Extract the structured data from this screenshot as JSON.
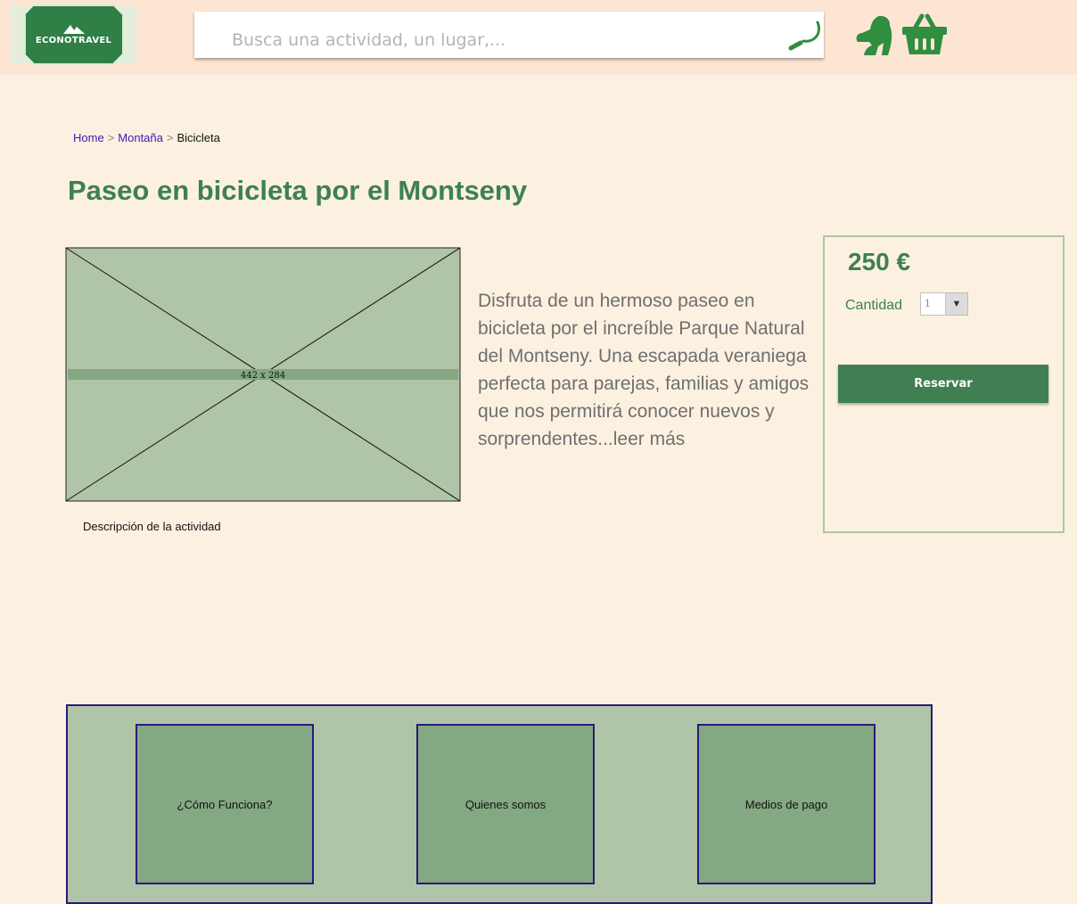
{
  "header": {
    "logo_text": "ECONOTRAVEL",
    "search": {
      "placeholder": "Busca una actividad, un lugar,..."
    }
  },
  "breadcrumb": [
    "Home",
    "Montaña",
    "Bicicleta"
  ],
  "page_title": "Paseo en bicicleta por el Montseny",
  "image": {
    "size_label": "442 x 284",
    "caption": "Descripción de la actividad"
  },
  "description": {
    "text": "Disfruta de un hermoso paseo en bicicleta por el increíble Parque Natural del Montseny. Una escapada veraniega perfecta para parejas, familias y amigos que nos permitirá conocer nuevos y sorprendentes",
    "read_more": "...leer más"
  },
  "booking": {
    "price": "250 €",
    "quantity_label": "Cantidad",
    "quantity_value": "1",
    "reserve_label": "Reservar"
  },
  "footer": {
    "links": [
      "¿Cómo Funciona?",
      "Quienes somos",
      "Medios de pago"
    ]
  },
  "colors": {
    "accent": "#3d8150",
    "header_bg": "#fde5d3",
    "page_bg": "#fcf1e1",
    "panel": "#b0c4a7"
  },
  "icons": [
    "search-icon",
    "gorilla-icon",
    "cart-icon",
    "dropdown-arrow-icon"
  ]
}
